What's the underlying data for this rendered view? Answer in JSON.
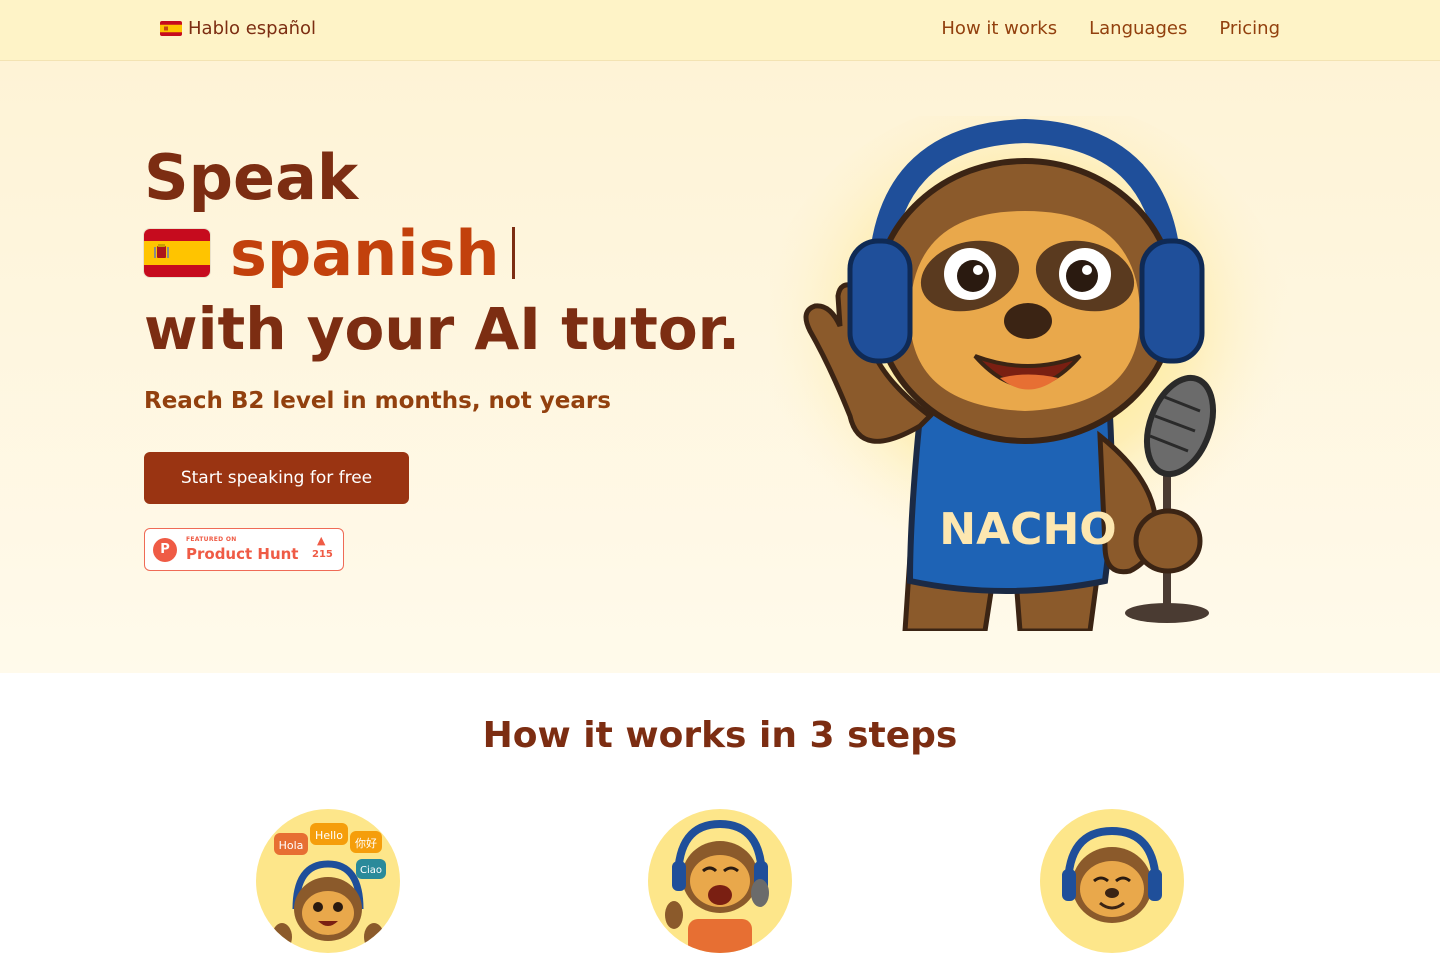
{
  "header": {
    "brand": "Hablo español",
    "nav": [
      "How it works",
      "Languages",
      "Pricing"
    ]
  },
  "hero": {
    "line1": "Speak",
    "language": "spanish",
    "line3": "with your AI tutor.",
    "subtitle": "Reach B2 level in months, not years",
    "cta": "Start speaking for free",
    "product_hunt": {
      "featured": "FEATURED ON",
      "name": "Product Hunt",
      "count": "215",
      "logo_letter": "P"
    },
    "mascot_shirt_text": "NACHO"
  },
  "steps": {
    "title": "How it works in 3 steps",
    "step1_bubbles": [
      "Hola",
      "Hello",
      "你好",
      "Ciao"
    ]
  },
  "colors": {
    "primary": "#9a3412",
    "heading": "#7c2d12",
    "accent": "#c2410c",
    "hero_bg": "#fef3d6",
    "producthunt": "#ef5b45"
  }
}
